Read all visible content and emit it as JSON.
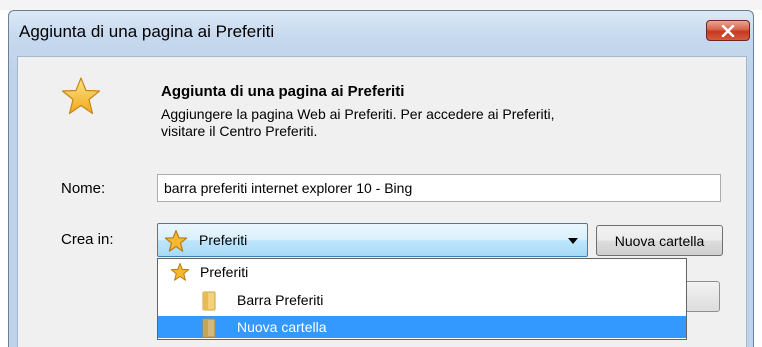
{
  "window": {
    "title": "Aggiunta di una pagina ai Preferiti",
    "close_label": "Chiudi"
  },
  "header": {
    "title": "Aggiunta di una pagina ai Preferiti",
    "description_line1": "Aggiungere la pagina Web ai Preferiti. Per accedere ai Preferiti,",
    "description_line2": "visitare il Centro Preferiti."
  },
  "form": {
    "name_label": "Nome:",
    "name_value": "barra preferiti internet explorer 10 - Bing",
    "create_in_label": "Crea in:",
    "create_in_value": "Preferiti",
    "new_folder_label": "Nuova cartella"
  },
  "dropdown": {
    "items": [
      {
        "label": "Preferiti",
        "icon": "star-icon",
        "selected": false
      },
      {
        "label": "Barra Preferiti",
        "icon": "folder-icon",
        "selected": false
      },
      {
        "label": "Nuova cartella",
        "icon": "folder-icon",
        "selected": true
      }
    ]
  },
  "colors": {
    "selection": "#3399ff",
    "star": "#f6b731",
    "close_button": "#c4391f"
  }
}
